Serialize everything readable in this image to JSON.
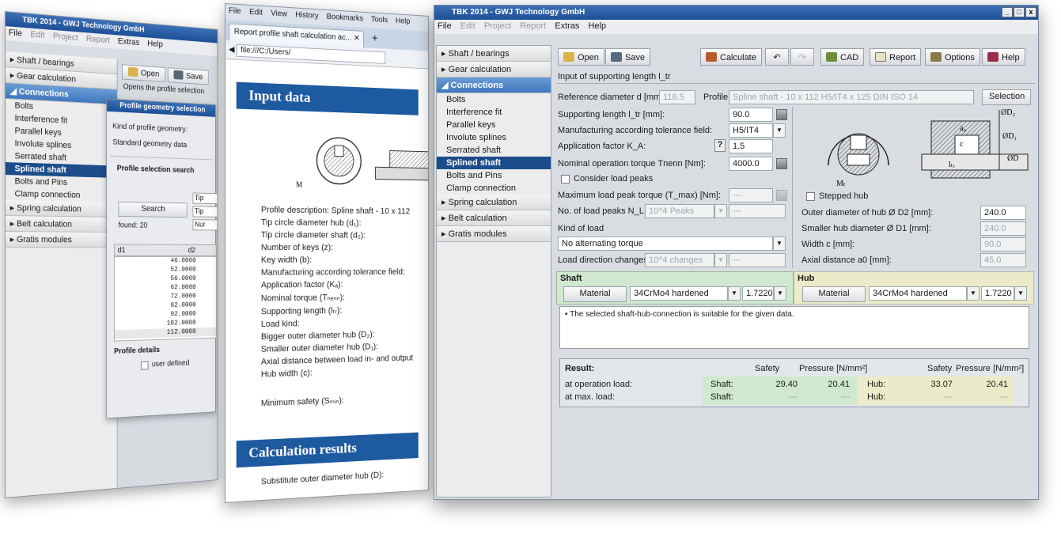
{
  "back_window": {
    "title": "TBK 2014 - GWJ Technology GmbH",
    "menu": [
      "File",
      "Edit",
      "Project",
      "Report",
      "Extras",
      "Help"
    ],
    "sidebar": {
      "items_top": [
        "Shaft / bearings",
        "Gear calculation"
      ],
      "active": "Connections",
      "subitems": [
        "Bolts",
        "Interference fit",
        "Parallel keys",
        "Involute splines",
        "Serrated shaft",
        "Splined shaft",
        "Bolts and Pins",
        "Clamp connection"
      ],
      "items_bottom": [
        "Spring calculation",
        "Belt calculation",
        "Gratis modules"
      ]
    },
    "toolbar": {
      "open": "Open",
      "save": "Save"
    },
    "hint": "Opens the profile selection",
    "dialog": {
      "title": "Profile geometry selection",
      "kind_label": "Kind of profile geometry:",
      "kind_value": "Standard geometry data",
      "search_title": "Profile selection search",
      "search_button": "Search",
      "found": "found: 20",
      "side_fields": [
        "Tip",
        "Tip",
        "Nur"
      ],
      "col_headers": [
        "d1",
        "d2"
      ],
      "values": [
        "46.0000",
        "52.0000",
        "56.0000",
        "62.0000",
        "72.0000",
        "82.0000",
        "92.0000",
        "102.0000",
        "112.0000"
      ],
      "details_title": "Profile details",
      "user_defined": "user defined"
    }
  },
  "browser": {
    "menu": [
      "File",
      "Edit",
      "View",
      "History",
      "Bookmarks",
      "Tools",
      "Help"
    ],
    "tab": "Report profile shaft calculation ac...",
    "url": "file:///C:/Users/",
    "section1": "Input data",
    "profile_desc": "Profile description:   Spline shaft - 10 x 112",
    "rows": [
      "Tip circle diameter hub (d₁):",
      "Tip circle diameter shaft (d₂):",
      "Number of keys (z):",
      "Key width (b):",
      "Manufacturing according tolerance field:",
      "Application factor (Kₐ):",
      "Nominal torque (Tₙₑₙₙ):",
      "Supporting length (lₜᵣ):",
      "Load kind:",
      "Bigger outer diameter hub (D₂):",
      "Smaller outer diameter hub (D₁):",
      "Axial distance between load in- and output",
      "Hub width (c):"
    ],
    "min_safety": "Minimum safety (Sₘᵢₙ):",
    "section2": "Calculation results",
    "result_row": "Substitute outer diameter hub (D):"
  },
  "main_window": {
    "title": "TBK 2014 - GWJ Technology GmbH",
    "controls": [
      "_",
      "□",
      "x"
    ],
    "menu": [
      "File",
      "Edit",
      "Project",
      "Report",
      "Extras",
      "Help"
    ],
    "sidebar": {
      "items_top": [
        "Shaft / bearings",
        "Gear calculation"
      ],
      "active": "Connections",
      "subitems": [
        "Bolts",
        "Interference fit",
        "Parallel keys",
        "Involute splines",
        "Serrated shaft",
        "Splined shaft",
        "Bolts and Pins",
        "Clamp connection"
      ],
      "selected": "Splined shaft",
      "items_bottom": [
        "Spring calculation",
        "Belt calculation",
        "Gratis modules"
      ]
    },
    "toolbar": {
      "open": "Open",
      "save": "Save",
      "calculate": "Calculate",
      "undo": "↶",
      "redo": "↷",
      "cad": "CAD",
      "report": "Report",
      "options": "Options",
      "help": "Help"
    },
    "status_line": "Input of supporting length l_tr",
    "form": {
      "ref_diameter_label": "Reference diameter d [mm]:",
      "ref_diameter_value": "118.5",
      "profile_label": "Profile:",
      "profile_value": "Spline shaft - 10 x 112 H5/IT4 x 125 DIN ISO 14",
      "selection_button": "Selection",
      "supporting_length_label": "Supporting length l_tr [mm]:",
      "supporting_length_value": "90.0",
      "tolerance_label": "Manufacturing according tolerance field:",
      "tolerance_value": "H5/IT4",
      "app_factor_label": "Application factor K_A:",
      "app_factor_help": "?",
      "app_factor_value": "1.5",
      "torque_label": "Nominal operation torque Tnenn [Nm]:",
      "torque_value": "4000.0",
      "load_peaks_check": "Consider load peaks",
      "max_torque_label": "Maximum load peak torque (T_max) [Nm]:",
      "max_torque_value": "---",
      "num_peaks_label": "No. of load peaks N_L:",
      "num_peaks_value": "10^4 Peaks",
      "num_peaks_extra": "---",
      "kind_of_load_label": "Kind of load",
      "kind_of_load_value": "No alternating torque",
      "load_dir_label": "Load direction changes:",
      "load_dir_value": "10^4 changes",
      "load_dir_extra": "---",
      "stepped_hub": "Stepped hub",
      "outer_d2_label": "Outer diameter of hub Ø D2 [mm]:",
      "outer_d2_value": "240.0",
      "smaller_d1_label": "Smaller hub diameter Ø D1 [mm]:",
      "smaller_d1_value": "240.0",
      "width_c_label": "Width c [mm]:",
      "width_c_value": "90.0",
      "axial_a0_label": "Axial distance a0 [mm]:",
      "axial_a0_value": "45.0"
    },
    "drawing_labels": {
      "d2": "ØD₂",
      "d1": "ØD₁",
      "d": "ØD",
      "a0": "a₀",
      "c": "c",
      "ltr": "lₜᵣ",
      "mt": "Mₜ"
    },
    "shaft": {
      "title": "Shaft",
      "material_button": "Material",
      "material": "34CrMo4 hardened",
      "number": "1.7220"
    },
    "hub": {
      "title": "Hub",
      "material_button": "Material",
      "material": "34CrMo4 hardened",
      "number": "1.7220"
    },
    "message": "• The selected shaft-hub-connection is suitable for the given data.",
    "results": {
      "title": "Result:",
      "headers": [
        "Safety",
        "Pressure [N/mm²]",
        "Safety",
        "Pressure [N/mm²]"
      ],
      "rows": [
        {
          "label": "at operation load:",
          "shaft_label": "Shaft:",
          "shaft_safety": "29.40",
          "shaft_pressure": "20.41",
          "hub_label": "Hub:",
          "hub_safety": "33.07",
          "hub_pressure": "20.41"
        },
        {
          "label": "at max. load:",
          "shaft_label": "Shaft:",
          "shaft_safety": "---",
          "shaft_pressure": "---",
          "hub_label": "Hub:",
          "hub_safety": "---",
          "hub_pressure": "---"
        }
      ]
    },
    "colors": {
      "titlebar": "#1e4f96",
      "sidebar_active": "#3f77bd",
      "selected": "#1c4c8c",
      "shaft_green": "#cfe8cf",
      "hub_yellow": "#ecebc9"
    }
  }
}
